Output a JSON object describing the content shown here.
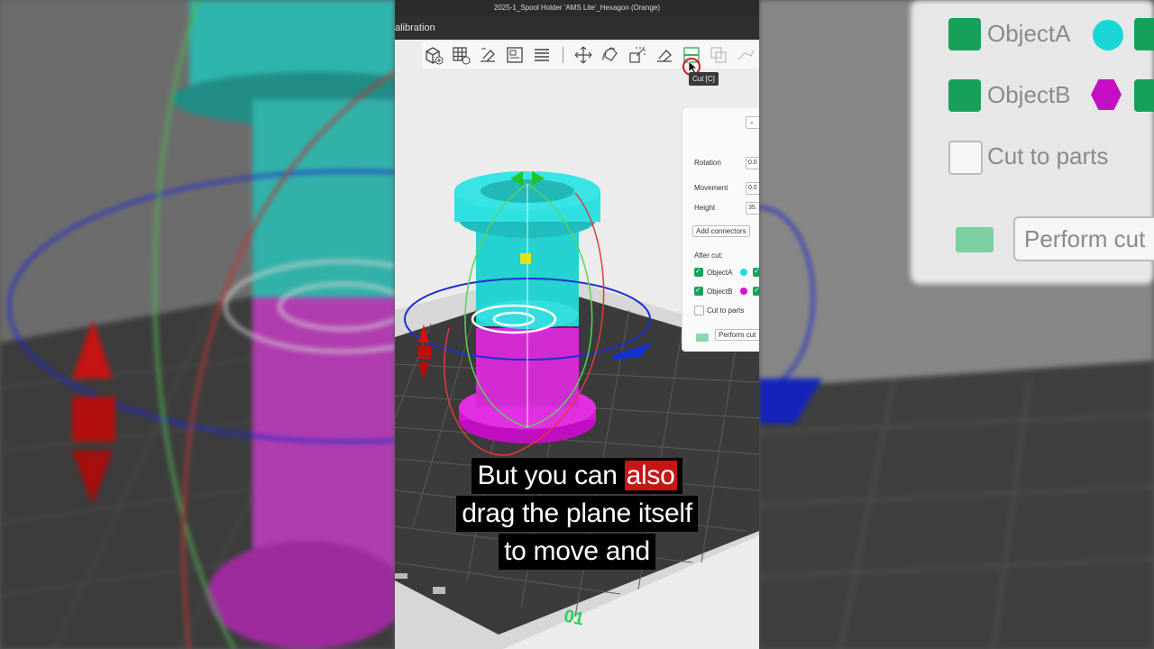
{
  "window": {
    "title": "2025-1_Spool Holder 'AMS Lite'_Hexagon (Orange)",
    "menu_item": "alibration"
  },
  "toolbar": {
    "icons": [
      "add-object-icon",
      "arrange-grid-icon",
      "auto-orient-icon",
      "plate-layout-icon",
      "split-layers-icon",
      "move-icon",
      "rotate-icon",
      "scale-icon",
      "lay-on-face-icon",
      "cut-icon",
      "boolean-icon",
      "support-paint-icon"
    ]
  },
  "tooltip": {
    "text": "Cut [C]"
  },
  "cut_panel": {
    "rotation_label": "Rotation",
    "rotation_value": "0.0",
    "movement_label": "Movement",
    "movement_value": "0.0",
    "height_label": "Height",
    "height_value": "35.",
    "add_connectors_label": "Add connectors",
    "after_cut_label": "After cut:",
    "objects": [
      {
        "name": "ObjectA",
        "checked": true,
        "color": "#19e0e0"
      },
      {
        "name": "ObjectB",
        "checked": true,
        "color": "#d60fd6"
      }
    ],
    "cut_to_parts_label": "Cut to parts",
    "cut_to_parts_checked": false,
    "perform_cut_label": "Perform cut"
  },
  "right_panel_zoom": {
    "object_a": "ObjectA",
    "object_b": "ObjectB",
    "cut_to_parts": "Cut to parts",
    "perform_cut": "Perform cut"
  },
  "caption": {
    "line1_pre": "But you can ",
    "line1_highlight": "also",
    "line2": "drag the plane itself",
    "line3": "to move and"
  },
  "plate": {
    "number": "01"
  },
  "colors": {
    "top_part": "#27d3d3",
    "bottom_part": "#d40fd4",
    "plane_ring_blue": "#1d2fd0",
    "ring_green": "#57d657",
    "ring_red": "#e03a3a",
    "highlight": "#c51616"
  }
}
